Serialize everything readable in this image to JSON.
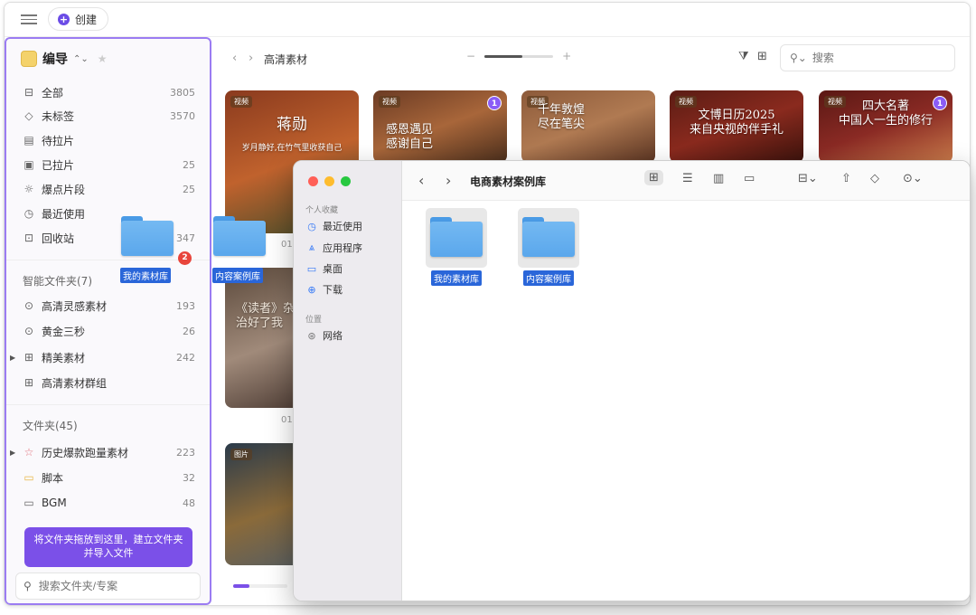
{
  "topbar": {
    "create_label": "创建"
  },
  "sidebar": {
    "library_title": "编导",
    "items": [
      {
        "label": "全部",
        "count": "3805",
        "icon": "inbox-icon"
      },
      {
        "label": "未标签",
        "count": "3570",
        "icon": "tag-icon"
      },
      {
        "label": "待拉片",
        "count": "",
        "icon": "clipboard-icon"
      },
      {
        "label": "已拉片",
        "count": "25",
        "icon": "clipboard-done-icon"
      },
      {
        "label": "爆点片段",
        "count": "25",
        "icon": "spark-icon"
      },
      {
        "label": "最近使用",
        "count": "",
        "icon": "clock-icon"
      },
      {
        "label": "回收站",
        "count": "347",
        "icon": "trash-icon"
      }
    ],
    "smart_section": "智能文件夹(7)",
    "smart_items": [
      {
        "label": "高清灵感素材",
        "count": "193"
      },
      {
        "label": "黄金三秒",
        "count": "26"
      },
      {
        "label": "精美素材",
        "count": "242"
      },
      {
        "label": "高清素材群组",
        "count": ""
      }
    ],
    "folders_section": "文件夹(45)",
    "folder_items": [
      {
        "label": "历史爆款跑量素材",
        "count": "223"
      },
      {
        "label": "脚本",
        "count": "32"
      },
      {
        "label": "BGM",
        "count": "48"
      }
    ],
    "tooltip": "将文件夹拖放到这里，建立文件夹并导入文件",
    "search_placeholder": "搜索文件夹/专案"
  },
  "main": {
    "breadcrumb": "高清素材",
    "search_placeholder": "搜索",
    "cards": [
      {
        "tag": "视频",
        "title": "蒋勋",
        "subtitle": "岁月静好,在竹气里收获自己",
        "badge": "",
        "colors": [
          "#8a3a1e",
          "#c0622d",
          "#3a4a2a"
        ]
      },
      {
        "tag": "视频",
        "title": "感恩遇见\n感谢自己",
        "subtitle": "",
        "badge": "1",
        "colors": [
          "#6b3b24",
          "#a8663a",
          "#4a2e1c"
        ]
      },
      {
        "tag": "视频",
        "title": "千年敦煌\n尽在笔尖",
        "subtitle": "",
        "badge": "",
        "colors": [
          "#8c5a3a",
          "#b07a52",
          "#5a3422"
        ]
      },
      {
        "tag": "视频",
        "title": "文博日历2025\n来自央视的伴手礼",
        "subtitle": "",
        "badge": "",
        "colors": [
          "#5a1c14",
          "#8a2a1e",
          "#3a120c"
        ]
      },
      {
        "tag": "视频",
        "title": "四大名著\n中国人一生的修行",
        "subtitle": "",
        "badge": "1",
        "colors": [
          "#5a1814",
          "#8a2a24",
          "#c87a4a"
        ]
      },
      {
        "tag": "",
        "title": "《读者》杂志\n治好了我",
        "subtitle": "",
        "badge": "",
        "colors": [
          "#5c4a3c",
          "#a08a7a",
          "#3a2a24"
        ]
      },
      {
        "tag": "图片",
        "title": "",
        "subtitle": "",
        "badge": "",
        "colors": [
          "#2a3a4a",
          "#8a6a3a",
          "#4a5a6a"
        ]
      }
    ],
    "timestamp_1": "01:",
    "timestamp_2": "01:"
  },
  "drag": {
    "folder_1": "我的素材库",
    "folder_2": "内容案例库",
    "count_badge": "2"
  },
  "finder": {
    "favorites_section": "个人收藏",
    "favorites": [
      {
        "label": "最近使用",
        "icon": "clock-icon"
      },
      {
        "label": "应用程序",
        "icon": "apps-icon"
      },
      {
        "label": "桌面",
        "icon": "desktop-icon"
      },
      {
        "label": "下载",
        "icon": "download-icon"
      }
    ],
    "locations_section": "位置",
    "locations": [
      {
        "label": "网络",
        "icon": "globe-icon"
      }
    ],
    "title": "电商素材案例库",
    "folders": [
      "我的素材库",
      "内容案例库"
    ]
  }
}
